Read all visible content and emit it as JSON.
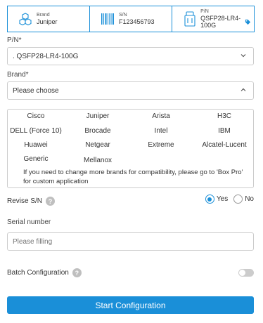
{
  "info_bar": {
    "brand": {
      "label": "Brand",
      "value": "Juniper",
      "icon": "cubes-icon"
    },
    "sn": {
      "label": "S/N",
      "value": "F123456793",
      "icon": "barcode-icon"
    },
    "pn": {
      "label": "P/N",
      "value": "QSFP28-LR4-100G",
      "icon": "transceiver-icon"
    }
  },
  "pn_field": {
    "label": "P/N*",
    "value": ". QSFP28-LR4-100G"
  },
  "brand_field": {
    "label": "Brand*",
    "placeholder": "Please choose"
  },
  "brands": [
    "Cisco",
    "Juniper",
    "Arista",
    "H3C",
    "DELL (Force 10)",
    "Brocade",
    "Intel",
    "IBM",
    "Huawei",
    "Netgear",
    "Extreme",
    "Alcatel-Lucent",
    "Generic",
    "Mellanox"
  ],
  "brand_note": "If you need to change more brands for compatibility, please go to 'Box Pro' for custom application",
  "revise_sn": {
    "label": "Revise S/N",
    "help": "?",
    "yes": "Yes",
    "no": "No",
    "selected": "Yes"
  },
  "serial": {
    "label": "Serial number",
    "placeholder": "Please filling"
  },
  "batch": {
    "label": "Batch Configuration",
    "help": "?",
    "enabled": false
  },
  "start_button": "Start Configuration",
  "colors": {
    "accent": "#1a8fd8",
    "border": "#cccccc",
    "help": "#bfbfbf"
  }
}
